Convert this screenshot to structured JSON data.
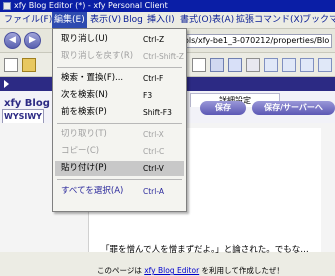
{
  "window": {
    "title": "xfy Blog Editor (*) - xfy Personal Client"
  },
  "menubar": {
    "items": [
      "ファイル(F)",
      "編集(E)",
      "表示(V)",
      "Blog",
      "挿入(I)",
      "書式(O)",
      "表(A)",
      "拡張コマンド(X)",
      "ブックマ"
    ]
  },
  "address": {
    "value": "ols/xfy-be1_3-070212/properties/Blo"
  },
  "blog": {
    "title": "xfy Blog",
    "settings_tab": "詳細設定",
    "wysiwyg_tab": "WYSIWY",
    "save_button": "保存",
    "save_server_button": "保存/サーバーへ"
  },
  "editor": {
    "quote": "「罪を憎んで人を憎まずだよ。」と論された。でもな…",
    "footer_pre": "このページは ",
    "footer_link": "xfy Blog Editor",
    "footer_post": " を利用して作成したぜ！"
  },
  "edit_menu": {
    "items": [
      {
        "label": "取り消し(U)",
        "shortcut": "Ctrl-Z"
      },
      {
        "label": "取り消しを戻す(R)",
        "shortcut": "Ctrl-Shift-Z"
      },
      {
        "label": "検索・置換(F)...",
        "shortcut": "Ctrl-F"
      },
      {
        "label": "次を検索(N)",
        "shortcut": "F3"
      },
      {
        "label": "前を検索(P)",
        "shortcut": "Shift-F3"
      },
      {
        "label": "切り取り(T)",
        "shortcut": "Ctrl-X"
      },
      {
        "label": "コピー(C)",
        "shortcut": "Ctrl-C"
      },
      {
        "label": "貼り付け(P)",
        "shortcut": "Ctrl-V"
      },
      {
        "label": "すべてを選択(A)",
        "shortcut": "Ctrl-A"
      }
    ]
  },
  "icons": {
    "back": "back-arrow-icon",
    "forward": "forward-arrow-icon",
    "app": "xfy-app-icon"
  },
  "colors": {
    "titlebar": "#0a1ea6",
    "menu_highlight": "#2e4bb0",
    "strip": "#2c2a84",
    "pill": "#5c58b4"
  }
}
